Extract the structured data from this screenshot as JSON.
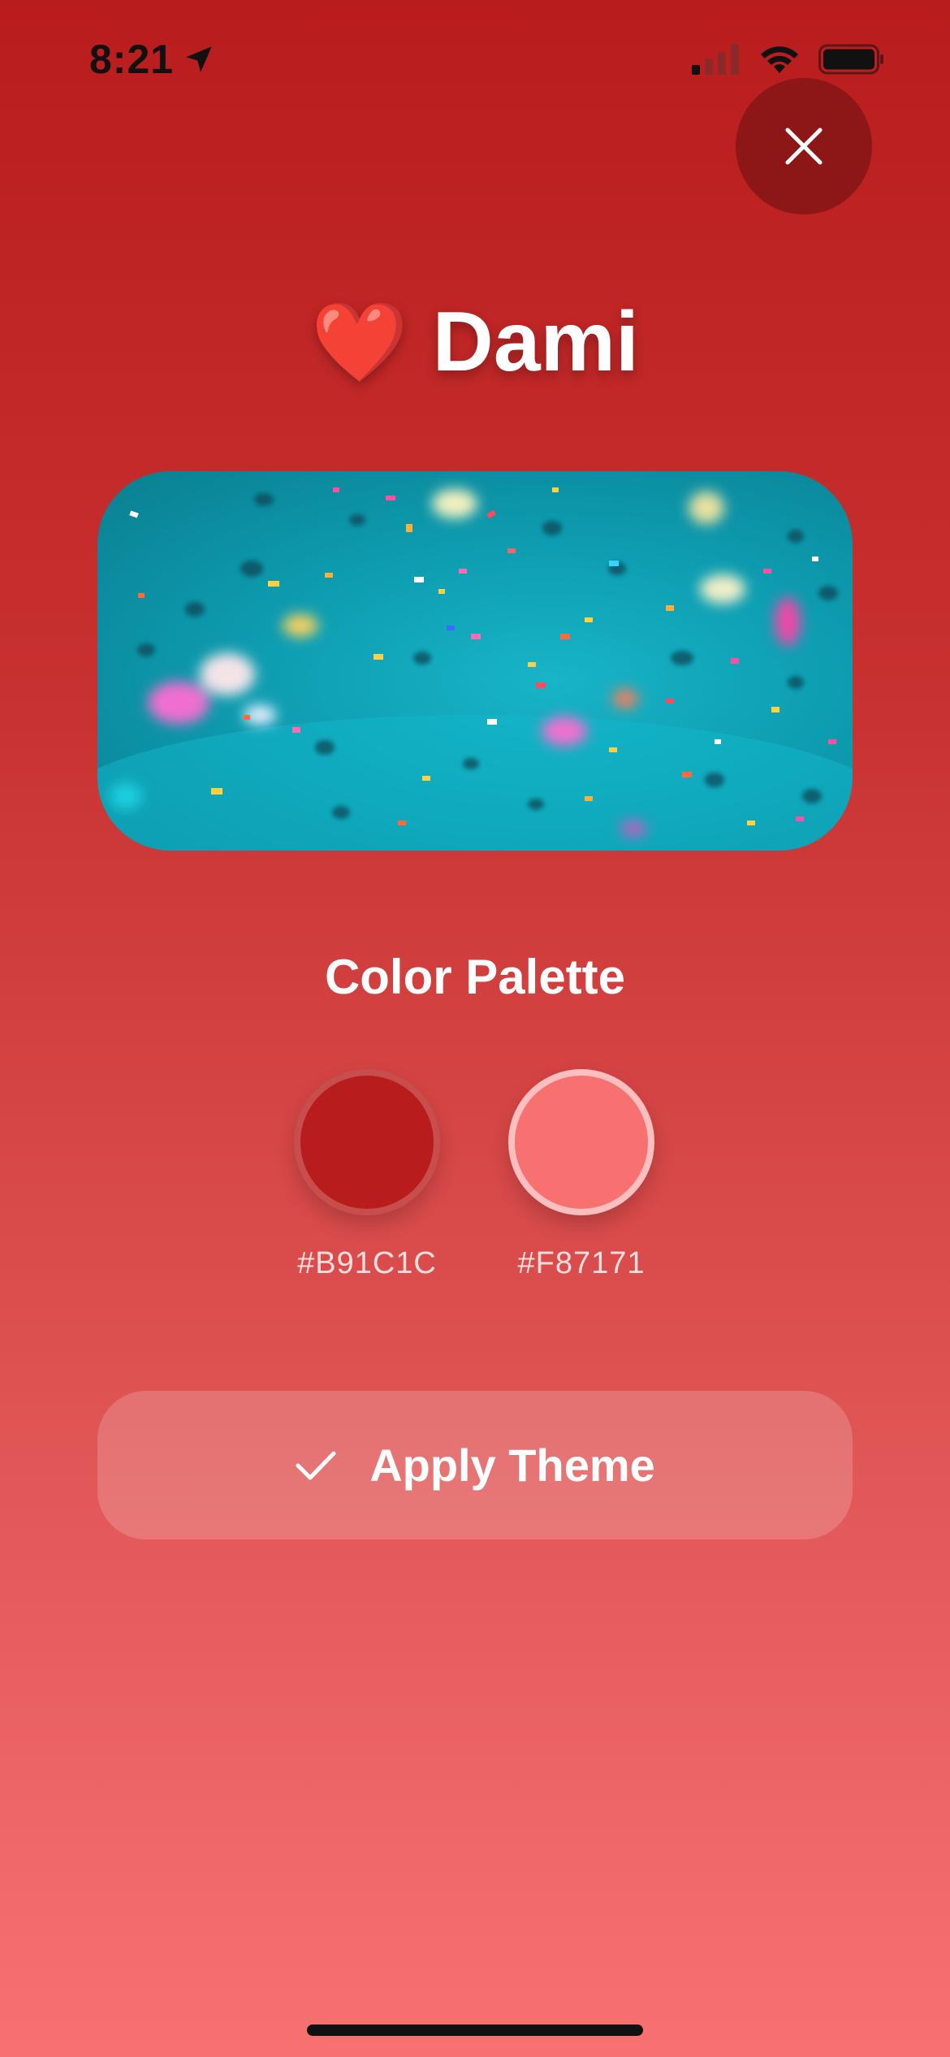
{
  "status_bar": {
    "time": "8:21",
    "location_icon": "location-arrow-icon",
    "signal_icon": "cellular-signal-icon",
    "wifi_icon": "wifi-icon",
    "battery_icon": "battery-icon"
  },
  "close_button": {
    "icon": "close-icon"
  },
  "header": {
    "emoji": "❤️",
    "title": "Dami"
  },
  "hero_image": {
    "description_icon": "confetti-image"
  },
  "palette": {
    "title": "Color Palette",
    "colors": [
      {
        "hex": "#B91C1C",
        "label": "#B91C1C"
      },
      {
        "hex": "#F87171",
        "label": "#F87171"
      }
    ]
  },
  "apply_button": {
    "label": "Apply Theme",
    "icon": "checkmark-icon"
  },
  "colors": {
    "background_top": "#b91c1c",
    "background_bottom": "#f87171",
    "close_bg": "#8d1717"
  }
}
